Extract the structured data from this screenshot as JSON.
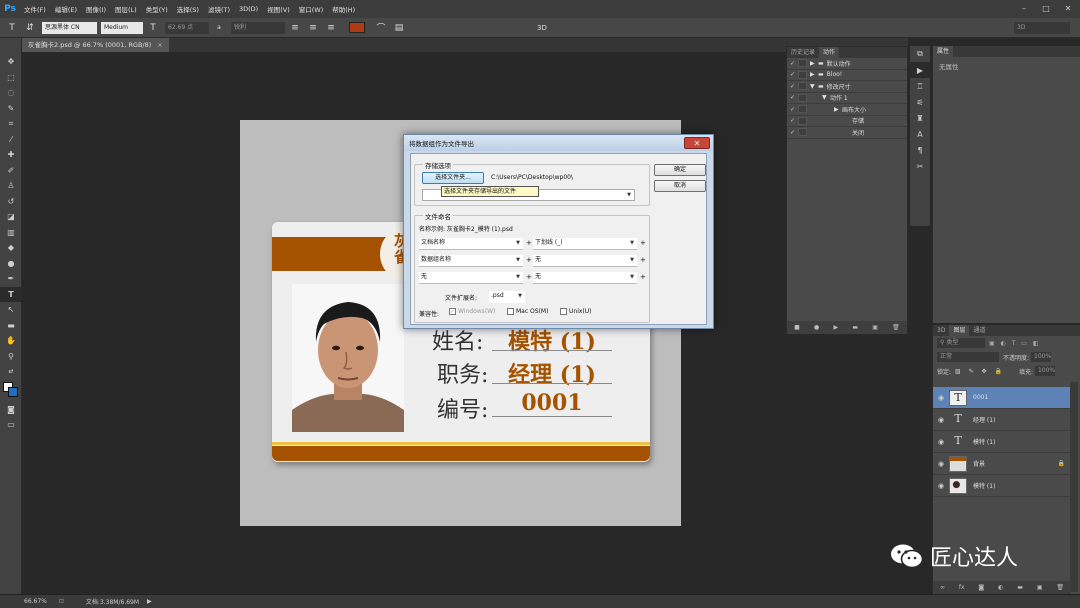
{
  "app": {
    "logo": "Ps"
  },
  "menu": [
    "文件(F)",
    "编辑(E)",
    "图像(I)",
    "图层(L)",
    "类型(Y)",
    "选择(S)",
    "滤镜(T)",
    "3D(D)",
    "视图(V)",
    "窗口(W)",
    "帮助(H)"
  ],
  "options_bar": {
    "font_family": "思源黑体 CN",
    "font_style": "Medium",
    "font_size": "62.69 点",
    "aa_label": "a",
    "aa_mode": "锐利",
    "mode_3d": "3D",
    "workspace": "3D",
    "text_color": "#b03a14"
  },
  "document_tab": {
    "title": "灰雀胸卡2.psd @ 66.7% (0001, RGB/8)",
    "close": "×"
  },
  "card": {
    "title_line1": "灰",
    "title_line2": "雀",
    "fields": [
      {
        "label": "姓名:",
        "value": "模特 (1)"
      },
      {
        "label": "职务:",
        "value": "经理 (1)"
      },
      {
        "label": "编号:",
        "value": "0001"
      }
    ],
    "accent_color": "#a55300"
  },
  "dialog": {
    "title": "将数据组作为文件导出",
    "close": "✕",
    "storage_group": "存储选项",
    "choose_folder_button": "选择文件夹...",
    "folder_path": "C:\\Users\\PC\\Desktop\\wp00\\",
    "tooltip": "选择文件夹存储导出的文件",
    "folder_dropdown_value": "",
    "ok_button": "确定",
    "cancel_button": "取消",
    "naming_group": "文件命名",
    "example_label": "名称示例: 灰雀胸卡2_模特 (1).psd",
    "naming_rows": [
      {
        "left": "文档名称",
        "right": "下划线 (_)"
      },
      {
        "left": "数据组名称",
        "right": "无"
      },
      {
        "left": "无",
        "right": "无"
      }
    ],
    "ext_label": "文件扩展名:",
    "ext_value": ".psd",
    "compat_label": "兼容性:",
    "compat_options": [
      "Windows(W)",
      "Mac OS(M)",
      "Unix(U)"
    ]
  },
  "actions_panel": {
    "tabs": [
      "历史记录",
      "动作"
    ],
    "rows": [
      {
        "check": "✓",
        "label": "默认动作",
        "indent": 0,
        "folder": true
      },
      {
        "check": "✓",
        "label": "Bloo!",
        "indent": 0,
        "folder": true
      },
      {
        "check": "✓",
        "label": "修改尺寸",
        "indent": 0,
        "folder": true
      },
      {
        "check": "✓",
        "label": "动作 1",
        "indent": 1,
        "folder": false
      },
      {
        "check": "✓",
        "label": "画布大小",
        "indent": 2,
        "folder": false
      },
      {
        "check": "✓",
        "label": "存储",
        "indent": 3,
        "folder": false
      },
      {
        "check": "✓",
        "label": "关闭",
        "indent": 3,
        "folder": false
      }
    ]
  },
  "properties_panel": {
    "tab": "属性",
    "empty_text": "无属性"
  },
  "layers_panel": {
    "tabs": [
      "3D",
      "图层",
      "通道"
    ],
    "filter": "类型",
    "blend_mode": "正常",
    "opacity_label": "不透明度:",
    "opacity_value": "100%",
    "lock_label": "锁定:",
    "fill_label": "填充:",
    "fill_value": "100%",
    "layers": [
      {
        "name": "0001",
        "type": "text",
        "selected": true
      },
      {
        "name": "经理 (1)",
        "type": "text",
        "selected": false
      },
      {
        "name": "模特 (1)",
        "type": "text",
        "selected": false
      },
      {
        "name": "背景",
        "type": "image",
        "selected": false,
        "locked": true
      },
      {
        "name": "模特 (1)",
        "type": "photo",
        "selected": false
      }
    ]
  },
  "status_bar": {
    "zoom": "66.67%",
    "doc_info": "文档:3.38M/6.69M"
  },
  "watermark": {
    "brand": "匠心达人"
  }
}
